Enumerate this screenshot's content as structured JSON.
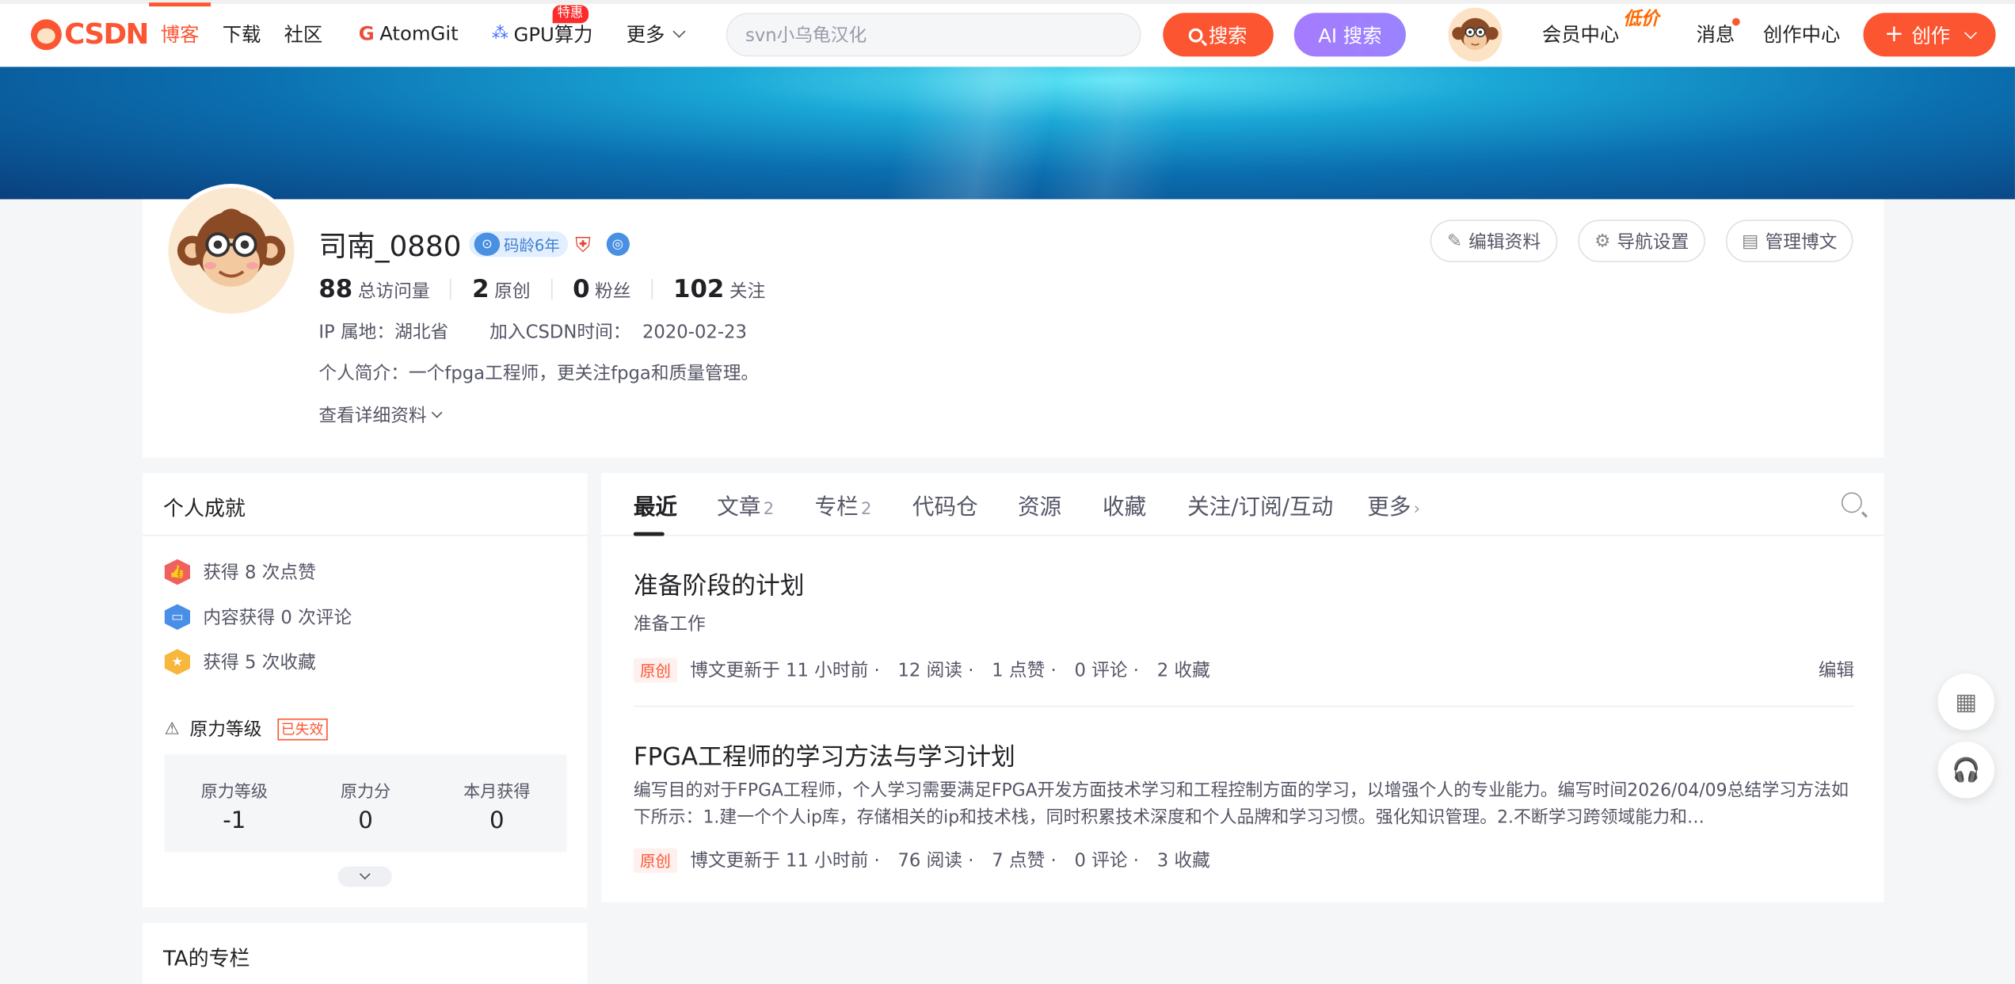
{
  "topbar": {
    "logo_text": "CSDN",
    "nav": [
      {
        "label": "博客"
      },
      {
        "label": "下载"
      },
      {
        "label": "社区"
      },
      {
        "label": "AtomGit"
      },
      {
        "label": "GPU算力"
      },
      {
        "label": "更多"
      }
    ],
    "gpu_badge": "特惠",
    "search_placeholder": "svn小乌龟汉化",
    "search_button": "搜索",
    "ai_search_button": "AI 搜索",
    "vip_center": "会员中心",
    "vip_badge": "低价",
    "messages": "消息",
    "creator_center": "创作中心",
    "create_button": "创作"
  },
  "profile": {
    "name": "司南_0880",
    "code_age": "码龄6年",
    "stats": [
      {
        "value": "88",
        "label": "总访问量"
      },
      {
        "value": "2",
        "label": "原创"
      },
      {
        "value": "0",
        "label": "粉丝"
      },
      {
        "value": "102",
        "label": "关注"
      }
    ],
    "ip_location": "IP 属地：湖北省",
    "join_time": "加入CSDN时间：  2020-02-23",
    "intro": "个人简介：一个fpga工程师，更关注fpga和质量管理。",
    "more_info": "查看详细资料",
    "buttons": {
      "edit": "编辑资料",
      "nav_settings": "导航设置",
      "manage": "管理博文"
    }
  },
  "achievements": {
    "title": "个人成就",
    "items": [
      {
        "text": "获得 8 次点赞",
        "color": "#f0605e"
      },
      {
        "text": "内容获得 0 次评论",
        "color": "#4a8fe7"
      },
      {
        "text": "获得 5 次收藏",
        "color": "#f7b73d"
      }
    ],
    "power_title": "原力等级",
    "power_status": "已失效",
    "power": [
      {
        "label": "原力等级",
        "value": "-1"
      },
      {
        "label": "原力分",
        "value": "0"
      },
      {
        "label": "本月获得",
        "value": "0"
      }
    ]
  },
  "column_card": {
    "title": "TA的专栏"
  },
  "tabs": [
    {
      "label": "最近",
      "count": ""
    },
    {
      "label": "文章",
      "count": "2"
    },
    {
      "label": "专栏",
      "count": "2"
    },
    {
      "label": "代码仓",
      "count": ""
    },
    {
      "label": "资源",
      "count": ""
    },
    {
      "label": "收藏",
      "count": ""
    },
    {
      "label": "关注/订阅/互动",
      "count": ""
    },
    {
      "label": "更多",
      "count": ""
    }
  ],
  "articles": [
    {
      "title": "准备阶段的计划",
      "summary": "准备工作",
      "tag": "原创",
      "updated": "博文更新于 11 小时前 ·",
      "reads": "12 阅读 ·",
      "likes": "1 点赞 ·",
      "comments": "0 评论 ·",
      "favs": "2 收藏",
      "edit": "编辑"
    },
    {
      "title": "FPGA工程师的学习方法与学习计划",
      "summary": "编写目的对于FPGA工程师，个人学习需要满足FPGA开发方面技术学习和工程控制方面的学习，以增强个人的专业能力。编写时间2026/04/09总结学习方法如下所示：1.建一个个人ip库，存储相关的ip和技术栈，同时积累技术深度和个人品牌和学习习惯。强化知识管理。2.不断学习跨领域能力和…",
      "tag": "原创",
      "updated": "博文更新于 11 小时前 ·",
      "reads": "76 阅读 ·",
      "likes": "7 点赞 ·",
      "comments": "0 评论 ·",
      "favs": "3 收藏"
    }
  ],
  "colors": {
    "accent": "#fc5531",
    "ai": "#a67bff"
  }
}
